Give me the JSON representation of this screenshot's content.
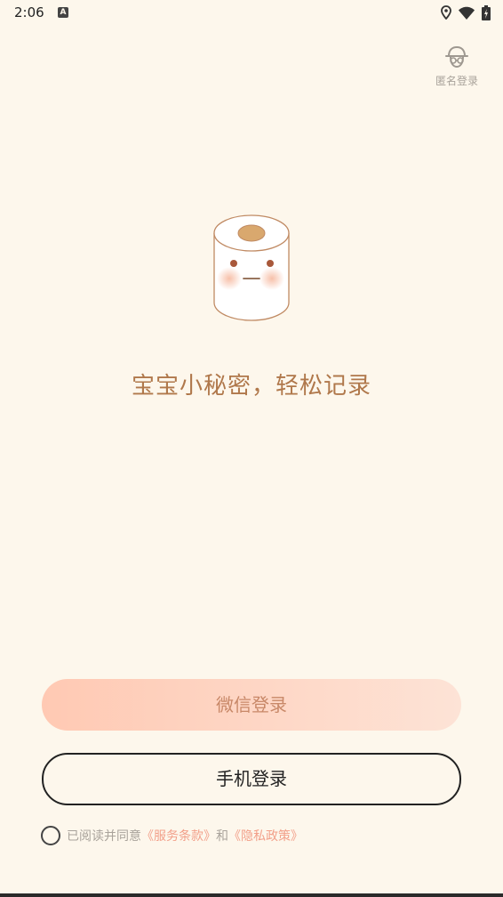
{
  "status_bar": {
    "time": "2:06",
    "notification_icon_letter": "A",
    "icons": [
      "location-icon",
      "wifi-icon",
      "battery-charging-icon"
    ]
  },
  "anon_login": {
    "icon": "anonymous-user-icon",
    "label": "匿名登录"
  },
  "mascot": {
    "icon": "tissue-roll-mascot-icon"
  },
  "slogan": "宝宝小秘密，轻松记录",
  "buttons": {
    "wechat_login": "微信登录",
    "phone_login": "手机登录"
  },
  "agreement": {
    "prefix": "已阅读并同意",
    "terms_link": "《服务条款》",
    "conjunction": "和",
    "privacy_link": "《隐私政策》",
    "checked": false
  },
  "colors": {
    "background": "#FDF7EC",
    "accent_brown": "#B0784B",
    "link_pink": "#F2A08A",
    "button_gradient_start": "#FFC9B3",
    "button_gradient_end": "#FDE3D6"
  }
}
